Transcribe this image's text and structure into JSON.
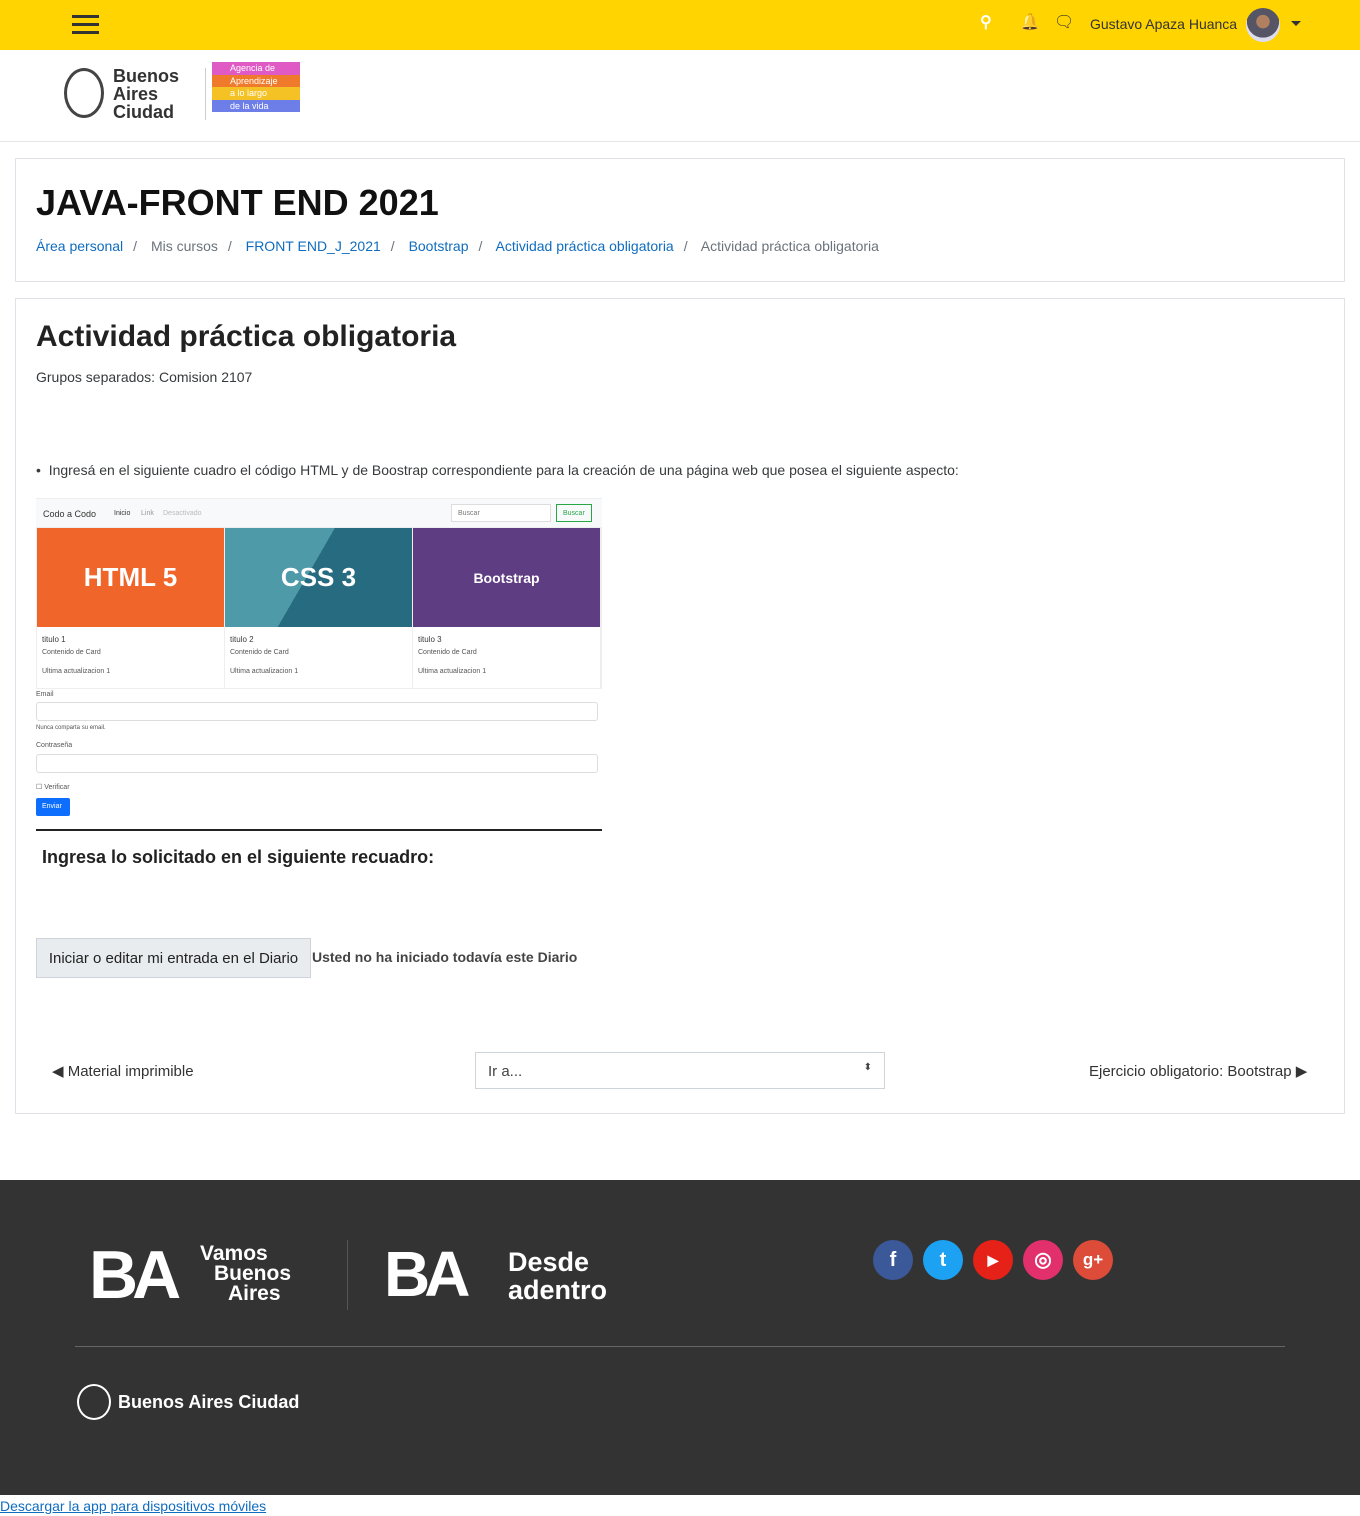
{
  "header": {
    "user_name": "Gustavo Apaza Huanca",
    "colors": {
      "bar": "#ffd400"
    }
  },
  "logos": {
    "city": "Buenos Aires Ciudad",
    "agency": [
      "Agencia de",
      "Aprendizaje",
      "a lo largo",
      "de la vida"
    ]
  },
  "course": {
    "title": "JAVA-FRONT END 2021",
    "breadcrumb": [
      "Área personal",
      "Mis cursos",
      "FRONT END_J_2021",
      "Bootstrap",
      "Actividad práctica obligatoria",
      "Actividad práctica obligatoria"
    ]
  },
  "activity": {
    "title": "Actividad práctica obligatoria",
    "groups": "Grupos separados: Comision 2107",
    "instruction": "Ingresá en el siguiente cuadro el código HTML y de Boostrap correspondiente para la creación de una página web que posea el siguiente aspecto:",
    "sample": {
      "brand": "Codo a Codo",
      "nav": [
        "Inicio",
        "Link",
        "Desactivado"
      ],
      "search_placeholder": "Buscar",
      "search_button": "Buscar",
      "cards": [
        {
          "img": "HTML 5",
          "title": "titulo 1",
          "text": "Contenido de Card",
          "updated": "Ultima actualizacion 1",
          "color": "#f06529"
        },
        {
          "img": "CSS 3",
          "title": "titulo 2",
          "text": "Contenido de Card",
          "updated": "Ultima actualizacion 1",
          "color": "#3f8a9b"
        },
        {
          "img": "Bootstrap",
          "title": "titulo 3",
          "text": "Contenido de Card",
          "updated": "Ultima actualizacion 1",
          "color": "#5f3d82"
        }
      ],
      "email_label": "Email",
      "email_help": "Nunca comparta su email.",
      "password_label": "Contraseña",
      "check_label": "Verificar",
      "submit": "Enviar"
    },
    "prompt": "Ingresa lo solicitado en el siguiente recuadro:",
    "diary_button": "Iniciar o editar mi entrada en el Diario",
    "diary_status": "Usted no ha iniciado todavía este Diario",
    "prev": "Material imprimible",
    "jump": "Ir a...",
    "next": "Ejercicio obligatorio: Bootstrap"
  },
  "footer": {
    "brand1": [
      "Vamos",
      "Buenos",
      "Aires"
    ],
    "brand2": [
      "Desde",
      "adentro"
    ],
    "city": "Buenos Aires Ciudad",
    "social": [
      {
        "name": "facebook",
        "glyph": "f",
        "color": "#3b5998"
      },
      {
        "name": "twitter",
        "glyph": "t",
        "color": "#1da1f2"
      },
      {
        "name": "youtube",
        "glyph": "▶",
        "color": "#e62117"
      },
      {
        "name": "instagram",
        "glyph": "◎",
        "color": "#e1306c"
      },
      {
        "name": "google-plus",
        "glyph": "g+",
        "color": "#dd4b39"
      }
    ]
  },
  "download_link": "Descargar la app para dispositivos móviles"
}
